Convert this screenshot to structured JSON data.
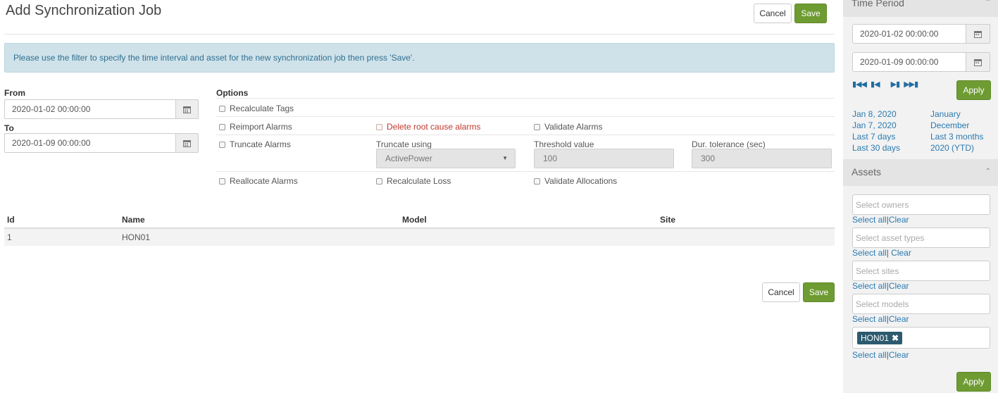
{
  "header": {
    "title": "Add Synchronization Job",
    "cancel_label": "Cancel",
    "save_label": "Save"
  },
  "info_message": "Please use the filter to specify the time interval and asset for the new synchronization job then press 'Save'.",
  "dates": {
    "from_label": "From",
    "from_value": "2020-01-02 00:00:00",
    "to_label": "To",
    "to_value": "2020-01-09 00:00:00"
  },
  "options": {
    "heading": "Options",
    "recalculate_tags": "Recalculate Tags",
    "reimport_alarms": "Reimport Alarms",
    "delete_root_cause_alarms": "Delete root cause alarms",
    "validate_alarms": "Validate Alarms",
    "truncate_alarms": "Truncate Alarms",
    "truncate_using_label": "Truncate using",
    "truncate_using_value": "ActivePower",
    "threshold_label": "Threshold value",
    "threshold_value": "100",
    "dur_tolerance_label": "Dur. tolerance (sec)",
    "dur_tolerance_value": "300",
    "reallocate_alarms": "Reallocate Alarms",
    "recalculate_loss": "Recalculate Loss",
    "validate_allocations": "Validate Allocations"
  },
  "table": {
    "columns": [
      "Id",
      "Name",
      "Model",
      "Site"
    ],
    "rows": [
      {
        "id": "1",
        "name": "HON01",
        "model": "",
        "site": ""
      }
    ]
  },
  "footer": {
    "cancel_label": "Cancel",
    "save_label": "Save"
  },
  "sidebar": {
    "time_period": {
      "title": "Time Period",
      "from_value": "2020-01-02 00:00:00",
      "to_value": "2020-01-09 00:00:00",
      "apply_label": "Apply",
      "quick_links_left": [
        "Jan 8, 2020",
        "Jan 7, 2020",
        "Last 7 days",
        "Last 30 days"
      ],
      "quick_links_right": [
        "January",
        "December",
        "Last 3 months",
        "2020 (YTD)"
      ]
    },
    "assets": {
      "title": "Assets",
      "owners_placeholder": "Select owners",
      "asset_types_placeholder": "Select asset types",
      "sites_placeholder": "Select sites",
      "models_placeholder": "Select models",
      "selected_asset_tag": "HON01",
      "select_all": "Select all",
      "separator": "|",
      "clear": "Clear",
      "apply_label": "Apply"
    }
  },
  "colors": {
    "accent_green": "#6e9b32",
    "info_bg": "#cfe2ea",
    "link_blue": "#2a7ab0",
    "danger_red": "#c0392b"
  }
}
